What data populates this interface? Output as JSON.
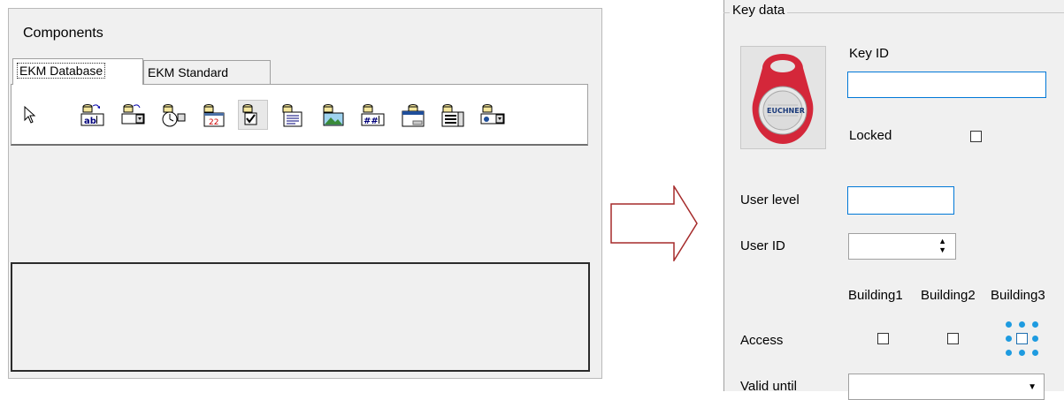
{
  "components_panel": {
    "title": "Components",
    "tabs": [
      {
        "label": "EKM Database",
        "active": true
      },
      {
        "label": "EKM Standard",
        "active": false
      }
    ],
    "tools": [
      {
        "name": "pointer-tool",
        "glyph": "⇱"
      },
      {
        "name": "db-text-field-tool"
      },
      {
        "name": "db-combo-tool"
      },
      {
        "name": "db-time-tool"
      },
      {
        "name": "db-date-tool"
      },
      {
        "name": "db-checkbox-tool"
      },
      {
        "name": "db-memo-tool"
      },
      {
        "name": "db-image-tool"
      },
      {
        "name": "db-numeric-field-tool"
      },
      {
        "name": "db-window-tool"
      },
      {
        "name": "db-list-tool"
      },
      {
        "name": "db-radio-tool"
      }
    ],
    "pressed_tool_index": 5
  },
  "key_data": {
    "group_title": "Key data",
    "key_id_label": "Key ID",
    "key_id_value": "",
    "locked_label": "Locked",
    "user_level_label": "User level",
    "user_level_value": "",
    "user_id_label": "User ID",
    "user_id_value": "",
    "access_label": "Access",
    "buildings": [
      "Building1",
      "Building2",
      "Building3"
    ],
    "valid_until_label": "Valid until",
    "valid_until_value": "",
    "key_image_brand": "EUCHNER"
  },
  "colors": {
    "focus_border": "#0078d7",
    "panel_bg": "#f0f0f0",
    "arrow": "#a52a2a",
    "key_red": "#d4273a"
  }
}
